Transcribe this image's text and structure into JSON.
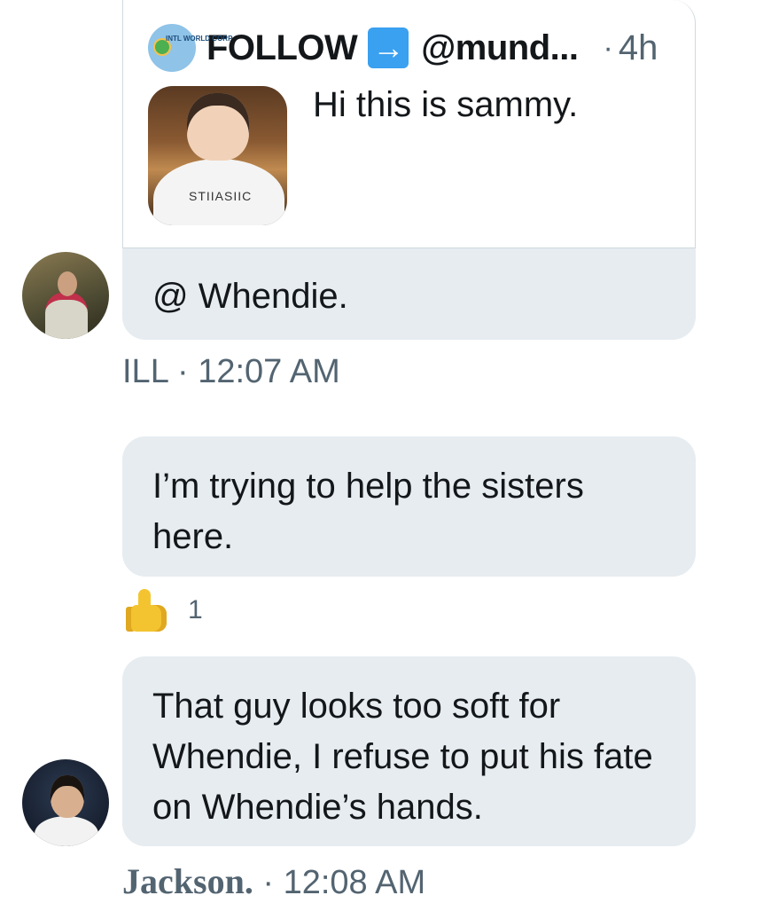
{
  "quote": {
    "logo_text": "INTL WORLD CORP",
    "account_name": "FOLLOW",
    "arrow": "→",
    "handle": "@mund...",
    "separator": "·",
    "time": "4h",
    "text": "Hi this is sammy.",
    "photo_shirt_text": "STIIASIIC"
  },
  "messages": [
    {
      "id": "ill-reply",
      "text": "@ Whendie.",
      "author": "ILL",
      "separator": "·",
      "time": "12:07 AM"
    },
    {
      "id": "help-sisters",
      "text": "I’m trying to help the sisters here.",
      "reaction": {
        "emoji": "thumbs-up",
        "count": "1"
      }
    },
    {
      "id": "jackson-msg",
      "text": "That guy looks too soft for Whendie, I refuse to put his fate on Whendie’s hands.",
      "author": "Jackson.",
      "separator": "·",
      "time": "12:08 AM"
    }
  ],
  "colors": {
    "bubble_bg": "#e6ecf0",
    "meta_text": "#536471",
    "arrow_bg": "#3aa0f0"
  }
}
